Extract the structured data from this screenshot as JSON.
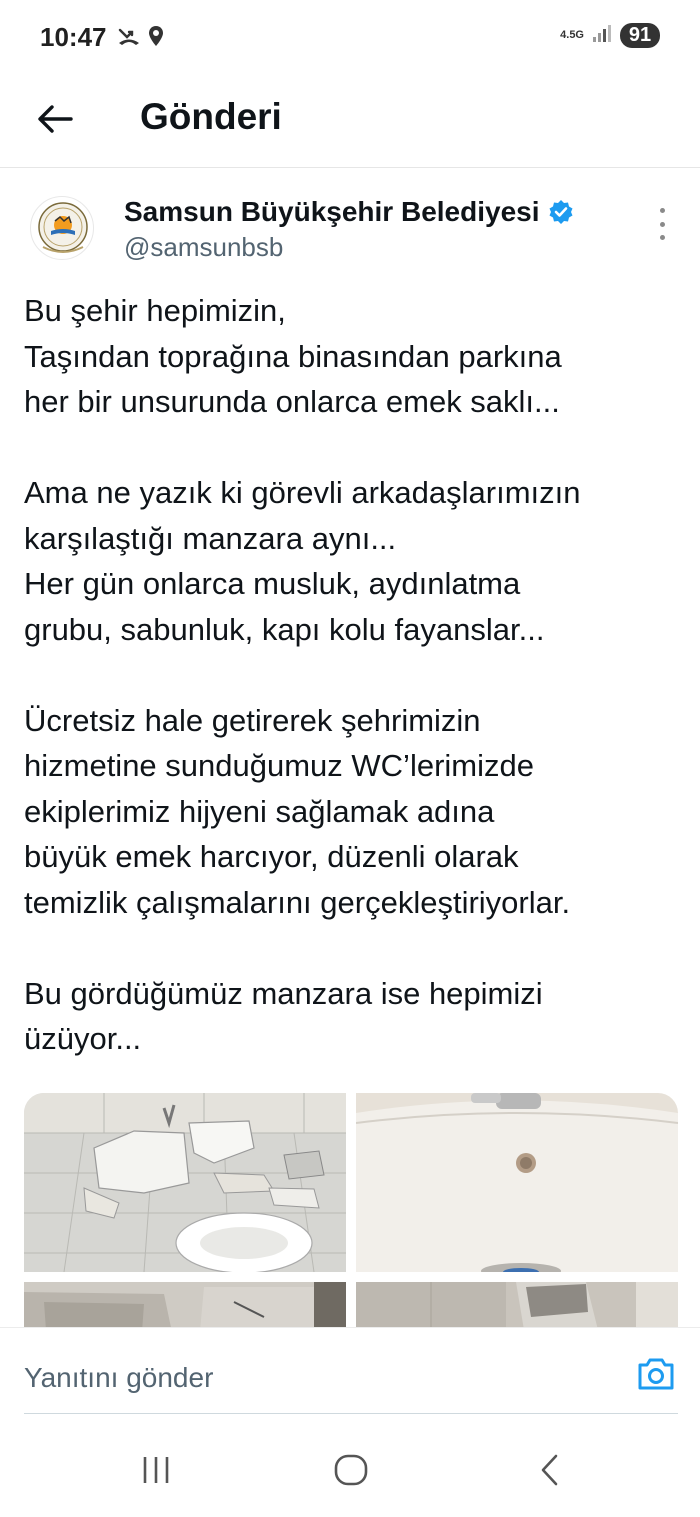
{
  "status_bar": {
    "time": "10:47",
    "network": "4.5G",
    "battery": "91",
    "icons": [
      "missed-call-icon",
      "location-icon",
      "signal-icon"
    ]
  },
  "header": {
    "title": "Gönderi"
  },
  "author": {
    "name": "Samsun Büyükşehir Belediyesi",
    "handle": "@samsunbsb",
    "verified": true,
    "verified_color": "#1d9bf0"
  },
  "post": {
    "paragraphs": [
      [
        "Bu şehir hepimizin,",
        "Taşından toprağına binasından parkına",
        "her bir unsurunda onlarca emek saklı..."
      ],
      [
        "Ama ne yazık ki görevli arkadaşlarımızın",
        "karşılaştığı manzara aynı...",
        "Her gün onlarca musluk, aydınlatma",
        "grubu, sabunluk, kapı kolu fayanslar..."
      ],
      [
        "Ücretsiz hale getirerek şehrimizin",
        "hizmetine sunduğumuz WC’lerimizde",
        "ekiplerimiz hijyeni sağlamak adına",
        "büyük emek harcıyor, düzenli olarak",
        "temizlik çalışmalarını gerçekleştiriyorlar."
      ],
      [
        "Bu gördüğümüz manzara ise hepimizi",
        "üzüyor..."
      ]
    ],
    "media": [
      "broken-toilet-photo",
      "sink-photo",
      "damaged-floor-photo",
      "bathroom-wall-photo"
    ]
  },
  "reply": {
    "placeholder": "Yanıtını gönder"
  },
  "colors": {
    "accent": "#1d9bf0",
    "text": "#0f1419",
    "secondary": "#536471"
  }
}
